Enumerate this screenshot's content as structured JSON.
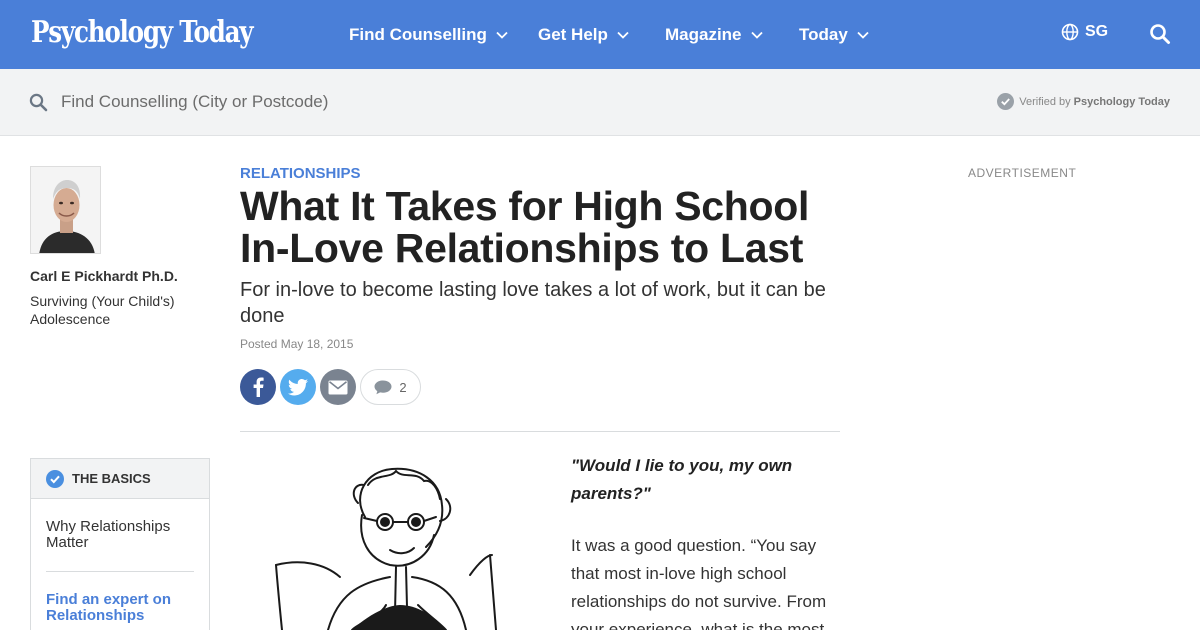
{
  "site": {
    "logo_text": "Psychology Today",
    "brand_color": "#4a7fd8"
  },
  "nav": {
    "items": [
      {
        "label": "Find Counselling",
        "icon": "chevron-down-icon"
      },
      {
        "label": "Get Help",
        "icon": "chevron-down-icon"
      },
      {
        "label": "Magazine",
        "icon": "chevron-down-icon"
      },
      {
        "label": "Today",
        "icon": "chevron-down-icon"
      }
    ],
    "region": "SG",
    "region_icon": "globe-icon",
    "search_icon": "search-icon"
  },
  "search": {
    "placeholder": "Find Counselling (City or Postcode)",
    "verified_prefix": "Verified by",
    "verified_brand": "Psychology Today"
  },
  "author": {
    "name": "Carl E Pickhardt Ph.D.",
    "blog": "Surviving (Your Child's) Adolescence"
  },
  "basics": {
    "heading": "THE BASICS",
    "link_1": "Why Relationships Matter",
    "link_2": "Find an expert on Relationships"
  },
  "article": {
    "topic": "RELATIONSHIPS",
    "title": "What It Takes for High School In-Love Relationships to Last",
    "subtitle": "For in-love to become lasting love takes a lot of work, but it can be done",
    "posted": "Posted May 18, 2015",
    "comment_count": "2",
    "quote": "\"Would I lie to you, my own parents?\"",
    "body_start": "It was a good question. “You say that most in-love high school relationships do not survive. From your experience, what is the most"
  },
  "share": {
    "facebook_color": "#3b5998",
    "twitter_color": "#55acee",
    "email_color": "#7a8390"
  },
  "sidebar": {
    "ad_label": "ADVERTISEMENT"
  }
}
